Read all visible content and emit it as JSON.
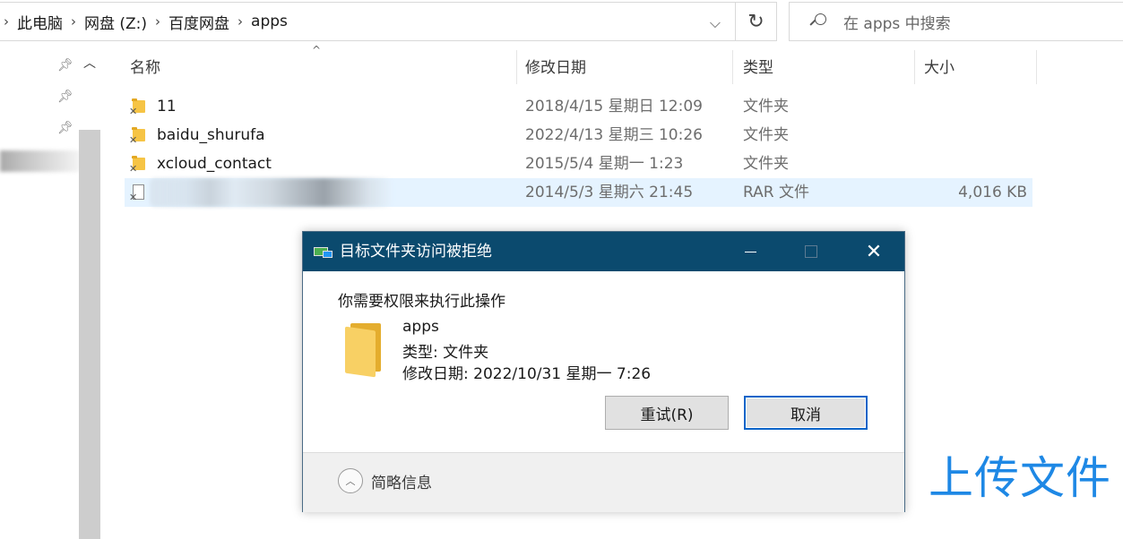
{
  "breadcrumb": [
    "此电脑",
    "网盘 (Z:)",
    "百度网盘",
    "apps"
  ],
  "search": {
    "placeholder": "在 apps 中搜索"
  },
  "columns": {
    "name": "名称",
    "modified": "修改日期",
    "type": "类型",
    "size": "大小"
  },
  "files": [
    {
      "name": "11",
      "modified": "2018/4/15 星期日 12:09",
      "type": "文件夹",
      "size": ""
    },
    {
      "name": "baidu_shurufa",
      "modified": "2022/4/13 星期三 10:26",
      "type": "文件夹",
      "size": ""
    },
    {
      "name": "xcloud_contact",
      "modified": "2015/5/4 星期一 1:23",
      "type": "文件夹",
      "size": ""
    },
    {
      "name": "",
      "modified": "2014/5/3 星期六 21:45",
      "type": "RAR 文件",
      "size": "4,016 KB"
    }
  ],
  "dialog": {
    "title": "目标文件夹访问被拒绝",
    "message": "你需要权限来执行此操作",
    "item_name": "apps",
    "item_type": "类型: 文件夹",
    "item_modified": "修改日期: 2022/10/31 星期一 7:26",
    "retry_label": "重试(R)",
    "cancel_label": "取消",
    "details_label": "简略信息"
  },
  "overlay_text": "上传文件",
  "colors": {
    "title_bar": "#0b4a6e",
    "selection": "#e5f3ff",
    "overlay": "#1e88e5",
    "folder": "#f6c445"
  }
}
